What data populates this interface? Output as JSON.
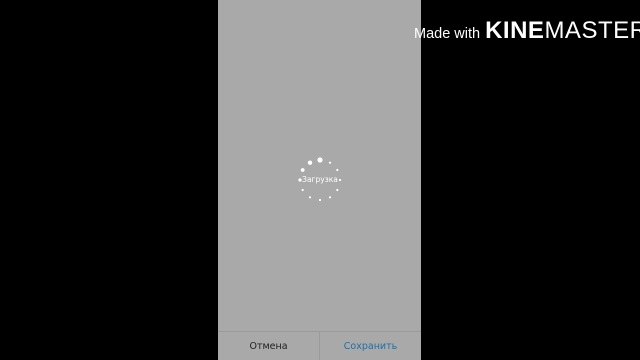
{
  "watermark": {
    "prefix": "Made with",
    "brand_bold": "KINE",
    "brand_light": "MASTER"
  },
  "loader": {
    "label": "Загрузка",
    "icon": "loading-spinner-icon"
  },
  "bottom_bar": {
    "cancel_label": "Отмена",
    "save_label": "Сохранить"
  },
  "colors": {
    "background": "#000000",
    "screen": "#a9a9a9",
    "save_accent": "#1f6fa8",
    "cancel_text": "#1e1e1e",
    "text_light": "#ffffff"
  }
}
